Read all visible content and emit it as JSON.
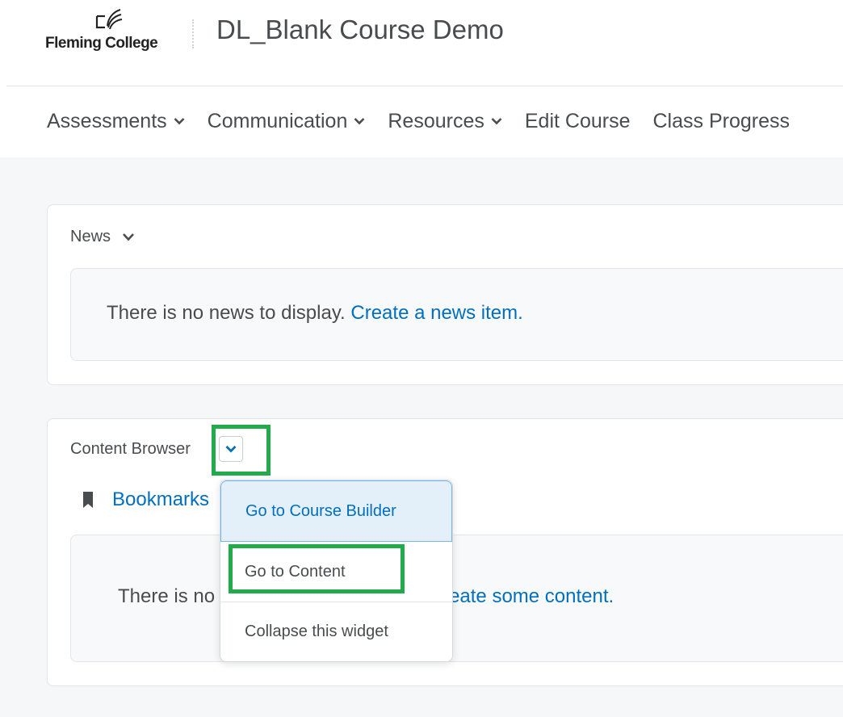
{
  "header": {
    "logo_text": "Fleming College",
    "course_title": "DL_Blank Course Demo"
  },
  "nav": {
    "items": [
      {
        "label": "Assessments",
        "has_dropdown": true
      },
      {
        "label": "Communication",
        "has_dropdown": true
      },
      {
        "label": "Resources",
        "has_dropdown": true
      },
      {
        "label": "Edit Course",
        "has_dropdown": false
      },
      {
        "label": "Class Progress",
        "has_dropdown": false
      }
    ]
  },
  "news_widget": {
    "title": "News",
    "empty_text": "There is no news to display.",
    "create_link": "Create a news item."
  },
  "content_widget": {
    "title": "Content Browser",
    "bookmarks_label": "Bookmarks",
    "empty_text_visible": "There is no",
    "create_link_visible": "eate some content."
  },
  "context_menu": {
    "items": [
      {
        "label": "Go to Course Builder",
        "state": "hover"
      },
      {
        "label": "Go to Content",
        "state": "highlighted"
      },
      {
        "label": "Collapse this widget",
        "state": "normal"
      }
    ]
  },
  "colors": {
    "link": "#006fbf",
    "text": "#494c4e",
    "highlight": "#22ab4b",
    "menu_hover_bg": "#e3eff9"
  }
}
